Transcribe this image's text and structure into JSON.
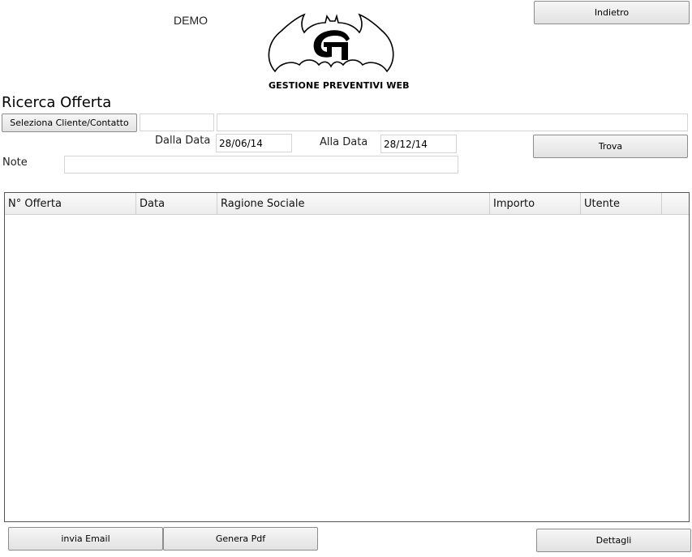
{
  "header": {
    "demo_label": "DEMO",
    "logo_caption": "GESTIONE PREVENTIVI WEB",
    "back_button": "Indietro"
  },
  "search": {
    "title": "Ricerca Offerta",
    "select_client_button": "Seleziona Cliente/Contatto",
    "client_code_value": "",
    "client_name_value": "",
    "from_date_label": "Dalla Data",
    "from_date_value": "28/06/14",
    "to_date_label": "Alla Data",
    "to_date_value": "28/12/14",
    "find_button": "Trova",
    "notes_label": "Note",
    "notes_value": ""
  },
  "table": {
    "columns": [
      "N° Offerta",
      "Data",
      "Ragione Sociale",
      "Importo",
      "Utente"
    ],
    "rows": []
  },
  "footer": {
    "email_button": "invia Email",
    "pdf_button": "Genera Pdf",
    "details_button": "Dettagli"
  }
}
